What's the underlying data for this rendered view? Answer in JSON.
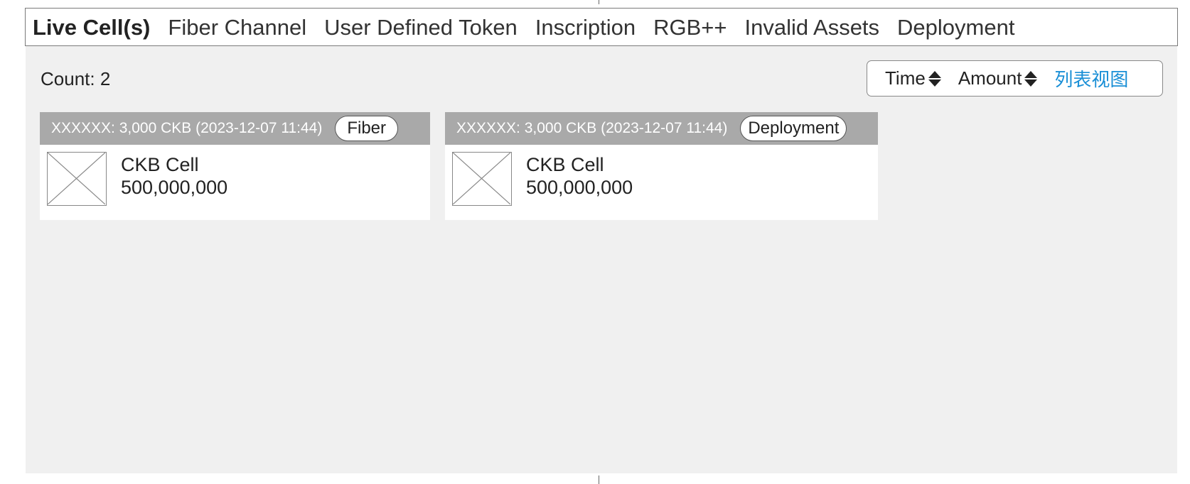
{
  "tabs": [
    {
      "label": "Live Cell(s)",
      "active": true
    },
    {
      "label": "Fiber Channel",
      "active": false
    },
    {
      "label": "User Defined Token",
      "active": false
    },
    {
      "label": "Inscription",
      "active": false
    },
    {
      "label": "RGB++",
      "active": false
    },
    {
      "label": "Invalid Assets",
      "active": false
    },
    {
      "label": "Deployment",
      "active": false
    }
  ],
  "count_label": "Count: 2",
  "sort": {
    "time_label": "Time",
    "amount_label": "Amount",
    "view_label": "列表视图",
    "view_color": "#1a8fd6"
  },
  "cards": [
    {
      "header": "XXXXXX: 3,000 CKB (2023-12-07 11:44)",
      "tag": "Fiber",
      "name": "CKB Cell",
      "amount": "500,000,000",
      "image": "placeholder-image-icon"
    },
    {
      "header": "XXXXXX: 3,000 CKB (2023-12-07 11:44)",
      "tag": "Deployment",
      "name": "CKB Cell",
      "amount": "500,000,000",
      "image": "placeholder-image-icon"
    }
  ],
  "colors": {
    "panel_bg": "#f0f0f0",
    "card_header_bg": "#a9a9a9",
    "accent": "#1a8fd6"
  }
}
